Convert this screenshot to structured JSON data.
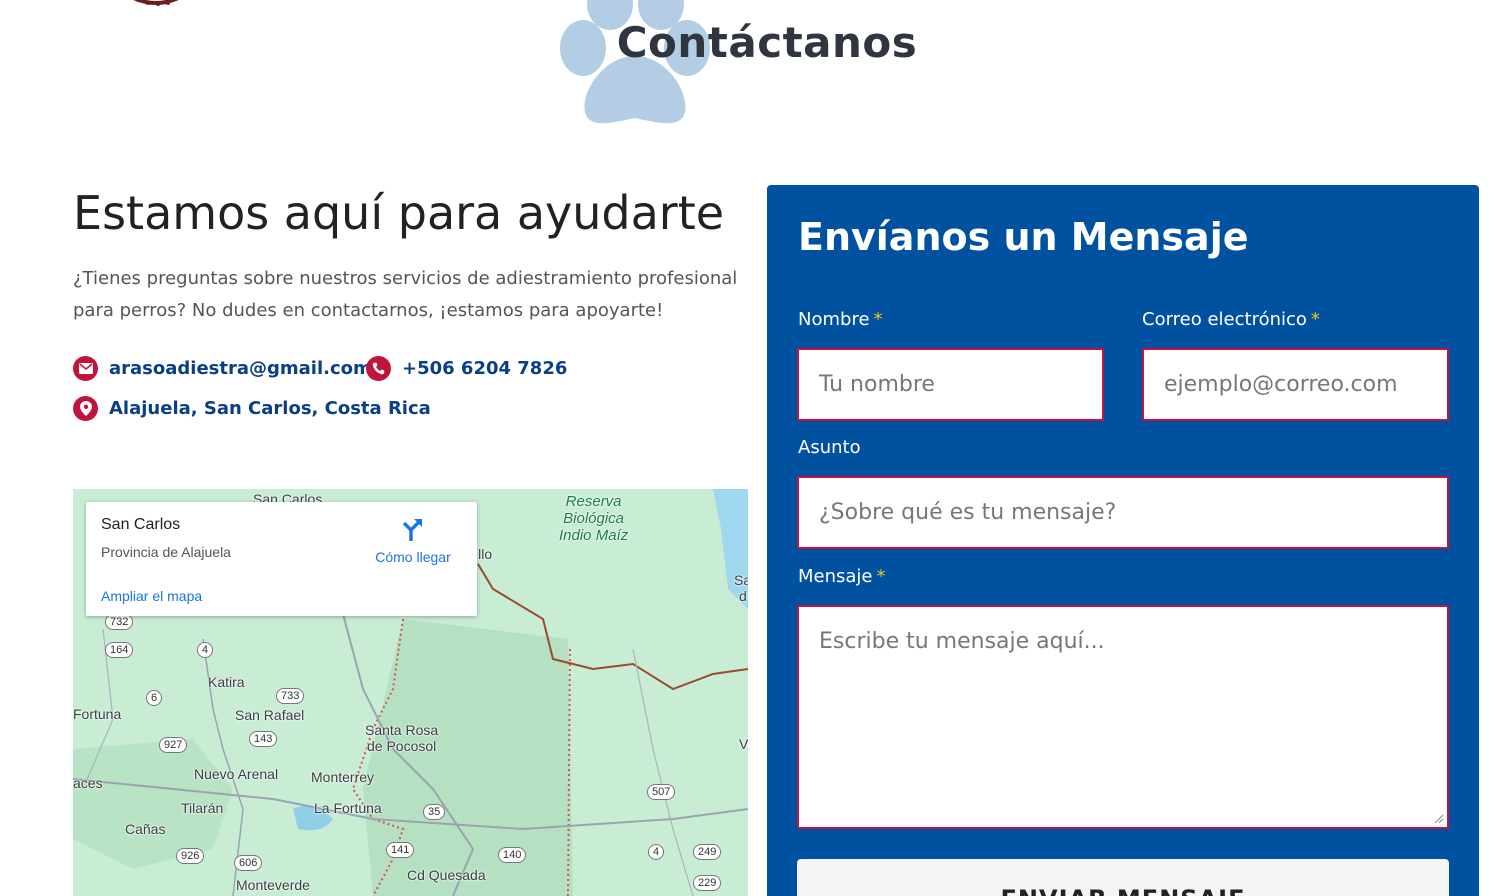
{
  "header": {
    "title": "Contáctanos"
  },
  "intro": {
    "heading": "Estamos aquí para ayudarte",
    "text": "¿Tienes preguntas sobre nuestros servicios de adiestramiento profesional para perros? No dudes en contactarnos, ¡estamos para apoyarte!"
  },
  "contact": {
    "email": "arasoadiestra@gmail.com",
    "phone": "+506 6204 7826",
    "location": "Alajuela, San Carlos, Costa Rica"
  },
  "map": {
    "place_name": "San Carlos",
    "region": "Provincia de Alajuela",
    "directions_label": "Cómo llegar",
    "enlarge_label": "Ampliar el mapa",
    "labels": {
      "san_carlos_top": "San Carlos",
      "reserva": "Reserva",
      "biologica": "Biológica",
      "indio_maiz": "Indio Maíz",
      "illo": "illo",
      "katira": "Katira",
      "fortuna": "Fortuna",
      "san_rafael": "San Rafael",
      "santa_rosa": "Santa Rosa",
      "de_pocosol": "de Pocosol",
      "nuevo_arenal": "Nuevo Arenal",
      "monterrey": "Monterrey",
      "aces": "aces",
      "tilaran": "Tilarán",
      "la_fortuna": "La Fortuna",
      "canas": "Cañas",
      "monteverde": "Monteverde",
      "cd_quesada": "Cd Quesada",
      "edge_sa": "Sa",
      "edge_d": "d",
      "edge_v": "V"
    },
    "shields": [
      "732",
      "164",
      "4",
      "733",
      "6",
      "143",
      "927",
      "507",
      "35",
      "926",
      "606",
      "141",
      "140",
      "4",
      "249",
      "229"
    ]
  },
  "form": {
    "title": "Envíanos un Mensaje",
    "name_label": "Nombre",
    "name_placeholder": "Tu nombre",
    "email_label": "Correo electrónico",
    "email_placeholder": "ejemplo@correo.com",
    "subject_label": "Asunto",
    "subject_placeholder": "¿Sobre qué es tu mensaje?",
    "message_label": "Mensaje",
    "message_placeholder": "Escribe tu mensaje aquí...",
    "required_mark": "*",
    "submit_label": "ENVIAR MENSAJE"
  },
  "colors": {
    "brand_blue": "#0052a0",
    "accent_red": "#c0143c",
    "link_blue": "#0a3f86",
    "paw": "#b3cde4",
    "required_yellow": "#f1c40f"
  }
}
